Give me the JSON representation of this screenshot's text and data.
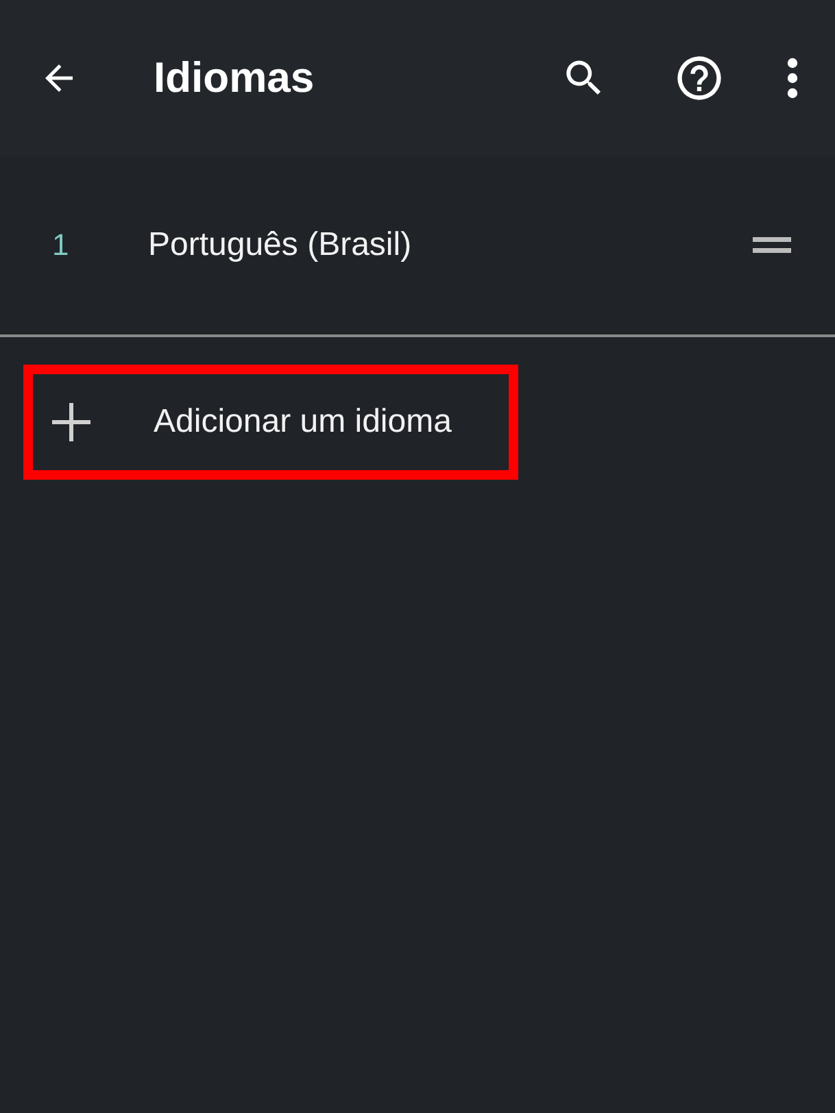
{
  "app_bar": {
    "title": "Idiomas"
  },
  "languages": [
    {
      "number": "1",
      "name": "Português (Brasil)"
    }
  ],
  "add_language": {
    "label": "Adicionar um idioma",
    "highlighted": true
  }
}
